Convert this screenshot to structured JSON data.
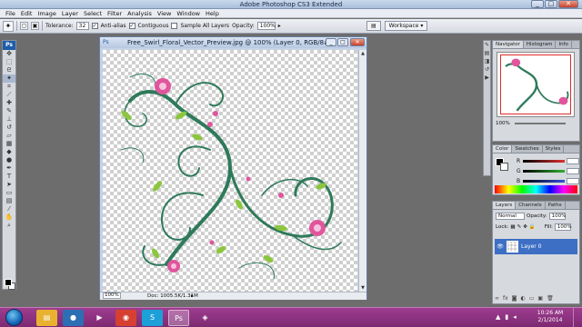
{
  "app": {
    "title": "Adobe Photoshop CS3 Extended"
  },
  "window_controls": {
    "minimize": "_",
    "maximize": "□",
    "close": "✕"
  },
  "menu": [
    "File",
    "Edit",
    "Image",
    "Layer",
    "Select",
    "Filter",
    "Analysis",
    "View",
    "Window",
    "Help"
  ],
  "options": {
    "tolerance_label": "Tolerance:",
    "tolerance_value": "32",
    "antialias_label": "Anti-alias",
    "contiguous_label": "Contiguous",
    "sample_all_label": "Sample All Layers",
    "opacity_label": "Opacity:",
    "opacity_value": "100%",
    "workspace_label": "Workspace ▾"
  },
  "document": {
    "title": "Free_Swirl_Floral_Vector_Preview.jpg @ 100% (Layer 0, RGB/8#)",
    "zoom": "100%",
    "doc_info": "Doc: 1005.5K/1.31M"
  },
  "navigator": {
    "tabs": [
      "Navigator",
      "Histogram",
      "Info"
    ],
    "zoom": "100%"
  },
  "color_panel": {
    "tabs": [
      "Color",
      "Swatches",
      "Styles"
    ],
    "channels": [
      {
        "label": "R",
        "value": "",
        "color": "#e03030"
      },
      {
        "label": "G",
        "value": "",
        "color": "#30b030"
      },
      {
        "label": "B",
        "value": "",
        "color": "#3050e0"
      }
    ]
  },
  "layers_panel": {
    "tabs": [
      "Layers",
      "Channels",
      "Paths"
    ],
    "blend_mode": "Normal",
    "opacity_label": "Opacity:",
    "opacity_value": "100%",
    "lock_label": "Lock:",
    "fill_label": "Fill:",
    "fill_value": "100%",
    "layer_name": "Layer 0"
  },
  "taskbar": {
    "time": "10:26 AM",
    "date": "2/1/2014"
  },
  "colors": {
    "taskbar": "#8c3280",
    "layer_selected": "#3d6fc4",
    "vine": "#2e7a5a",
    "flower": "#e0559c",
    "leaf": "#8cc63f"
  }
}
